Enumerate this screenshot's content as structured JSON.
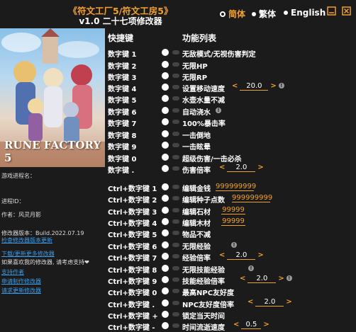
{
  "header": {
    "title": "《符文工厂5/符文工房5》",
    "subtitle": "v1.0 二十七项修改器",
    "languages": [
      "简体",
      "繁体",
      "English"
    ],
    "selected_language": "简体"
  },
  "columns": {
    "hotkey": "快捷键",
    "features": "功能列表"
  },
  "sidebar": {
    "cover_logo": "RUNE FACTORY 5",
    "game_process_label": "游戏进程名：",
    "process_id_label": "进程ID：",
    "author": "作者：风灵月影",
    "version": "修改器版本：Build.2022.07.19",
    "check_update": "检查修改器版本更新",
    "links": [
      "下载/更新更多修改器",
      "如果喜欢我的修改器, 请考虑支持❤",
      "支持作者",
      "申请制作修改器",
      "请求更新修改器"
    ]
  },
  "cheats": [
    {
      "key": "数字键 1",
      "label": "无敌模式/无视伤害判定"
    },
    {
      "key": "数字键 2",
      "label": "无限HP"
    },
    {
      "key": "数字键 3",
      "label": "无限RP"
    },
    {
      "key": "数字键 4",
      "label": "设置移动速度",
      "value": "20.0"
    },
    {
      "key": "数字键 5",
      "label": "水壶水量不减"
    },
    {
      "key": "数字键 6",
      "label": "自动浇水"
    },
    {
      "key": "数字键 7",
      "label": "100%暴击率"
    },
    {
      "key": "数字键 8",
      "label": "一击倒地"
    },
    {
      "key": "数字键 9",
      "label": "一击眩晕"
    },
    {
      "key": "数字键 0",
      "label": "超级伤害/一击必杀"
    },
    {
      "key": "数字键 .",
      "label": "伤害倍率",
      "value": "2.0"
    },
    {
      "key": "Ctrl+数字键 1",
      "label": "编辑金钱",
      "input": "999999999"
    },
    {
      "key": "Ctrl+数字键 2",
      "label": "编辑种子点数",
      "input": "999999999"
    },
    {
      "key": "Ctrl+数字键 3",
      "label": "编辑石材",
      "input": "99999"
    },
    {
      "key": "Ctrl+数字键 4",
      "label": "编辑木材",
      "input": "99999"
    },
    {
      "key": "Ctrl+数字键 5",
      "label": "物品不减"
    },
    {
      "key": "Ctrl+数字键 6",
      "label": "无限经验"
    },
    {
      "key": "Ctrl+数字键 7",
      "label": "经验倍率",
      "value": "2.0"
    },
    {
      "key": "Ctrl+数字键 8",
      "label": "无限技能经验"
    },
    {
      "key": "Ctrl+数字键 9",
      "label": "技能经验倍率",
      "value": "2.0"
    },
    {
      "key": "Ctrl+数字键 0",
      "label": "最高NPC友好度"
    },
    {
      "key": "Ctrl+数字键 .",
      "label": "NPC友好度倍率",
      "value": "2.0"
    },
    {
      "key": "Ctrl+数字键 +",
      "label": "锁定当天时间"
    },
    {
      "key": "Ctrl+数字键 -",
      "label": "时间流逝速度",
      "value": "0.5"
    }
  ],
  "colors": {
    "accent": "#f0a030",
    "background": "#1b1b1b",
    "link": "#3a9be8"
  }
}
